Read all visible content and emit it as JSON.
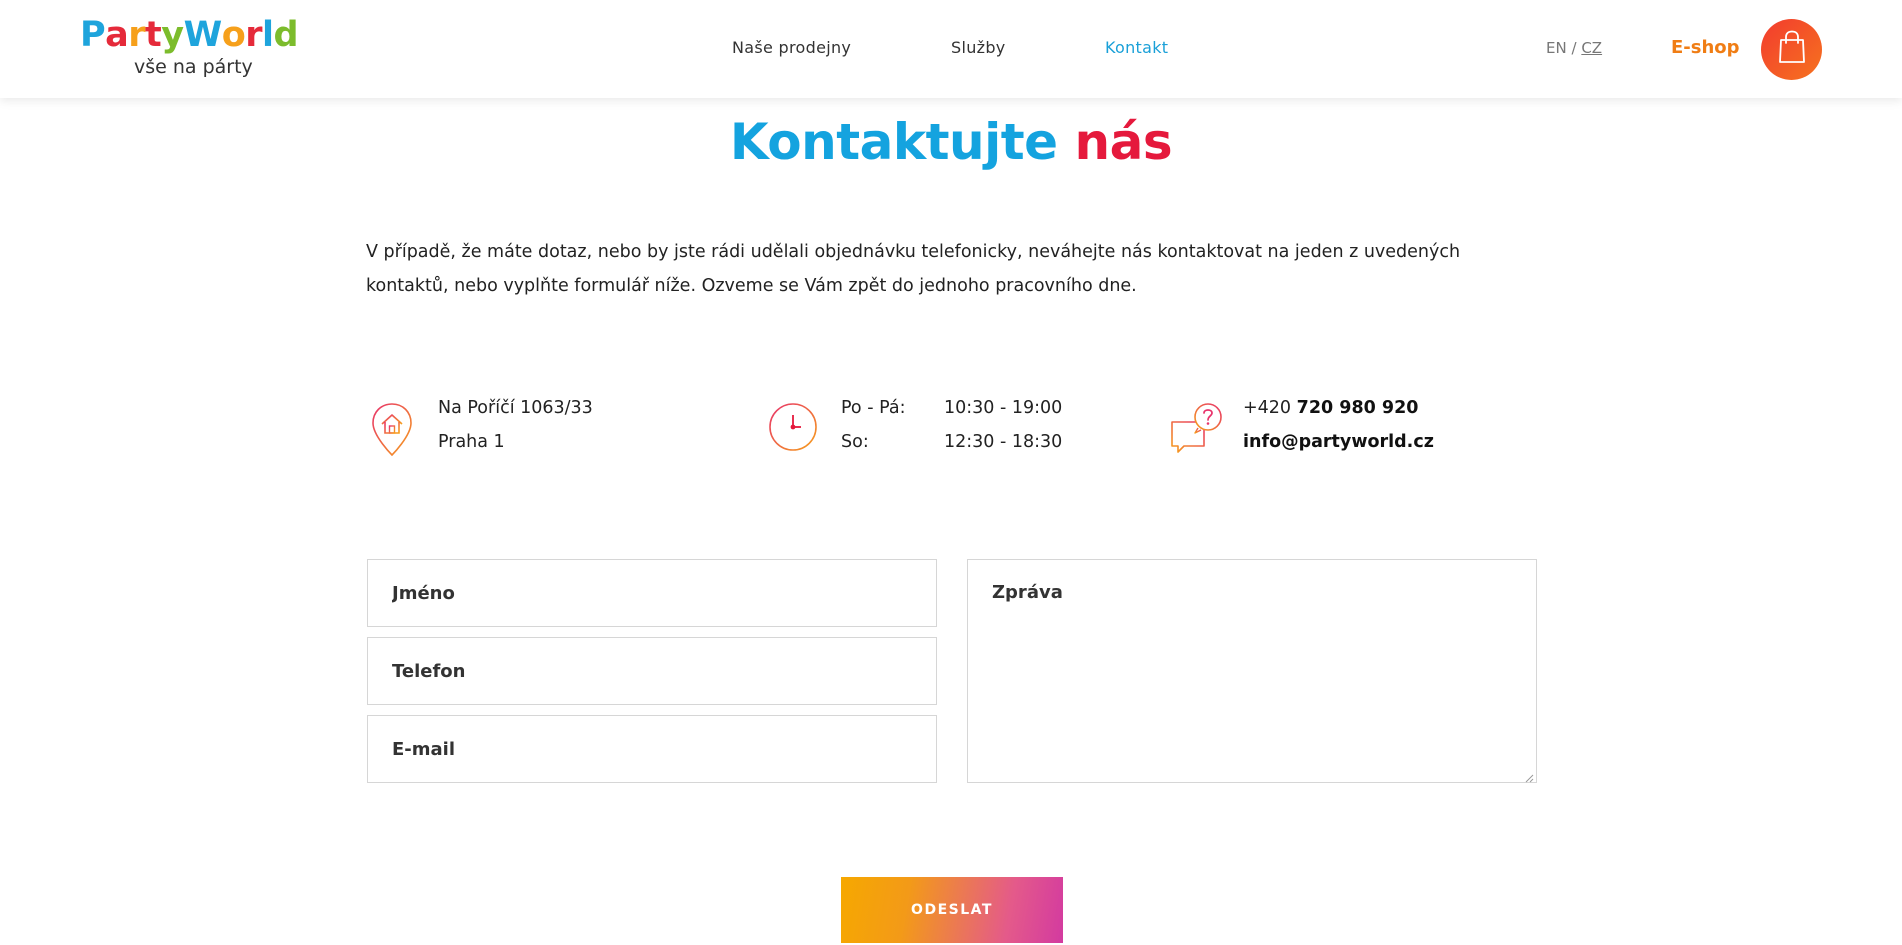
{
  "header": {
    "logo": {
      "word_letters": [
        {
          "ch": "P",
          "color": "#1ea4dc"
        },
        {
          "ch": "a",
          "color": "#e52a3a"
        },
        {
          "ch": "r",
          "color": "#f6a01b"
        },
        {
          "ch": "t",
          "color": "#e52a3a"
        },
        {
          "ch": "y",
          "color": "#7cbc2c"
        },
        {
          "ch": "W",
          "color": "#1ea4dc"
        },
        {
          "ch": "o",
          "color": "#f6a01b"
        },
        {
          "ch": "r",
          "color": "#e52a3a"
        },
        {
          "ch": "l",
          "color": "#1ea4dc"
        },
        {
          "ch": "d",
          "color": "#7cbc2c"
        }
      ],
      "tagline": "vše na párty"
    },
    "nav": [
      {
        "label": "Naše prodejny",
        "active": false
      },
      {
        "label": "Služby",
        "active": false
      },
      {
        "label": "Kontakt",
        "active": true
      }
    ],
    "lang": {
      "en": "EN",
      "separator": "/",
      "cz": "CZ"
    },
    "eshop_label": "E-shop",
    "cart_icon": "shopping-bag-icon"
  },
  "main": {
    "title_part1": "Kontaktujte",
    "title_part2": "nás",
    "intro_line1": "V případě, že máte dotaz, nebo by jste rádi udělali objednávku telefonicky, neváhejte nás kontaktovat na jeden z uvedených",
    "intro_line2": "kontaktů, nebo vyplňte formulář níže. Ozveme se Vám zpět do jednoho pracovního dne.",
    "address": {
      "icon": "location-pin-icon",
      "line1": "Na Poříčí 1063/33",
      "line2": "Praha 1"
    },
    "hours": {
      "icon": "clock-icon",
      "weekday_label": "Po - Pá:",
      "weekday_time": "10:30 - 19:00",
      "saturday_label": "So:",
      "saturday_time": "12:30 - 18:30"
    },
    "contact": {
      "icon": "chat-question-icon",
      "phone_prefix": "+420",
      "phone_number": "720 980 920",
      "email": "info@partyworld.cz"
    }
  },
  "form": {
    "name_placeholder": "Jméno",
    "phone_placeholder": "Telefon",
    "email_placeholder": "E-mail",
    "message_placeholder": "Zpráva",
    "submit_label": "ODESLAT"
  },
  "colors": {
    "accent_blue": "#14a3df",
    "accent_red": "#e5193c",
    "accent_orange": "#f07d14"
  }
}
